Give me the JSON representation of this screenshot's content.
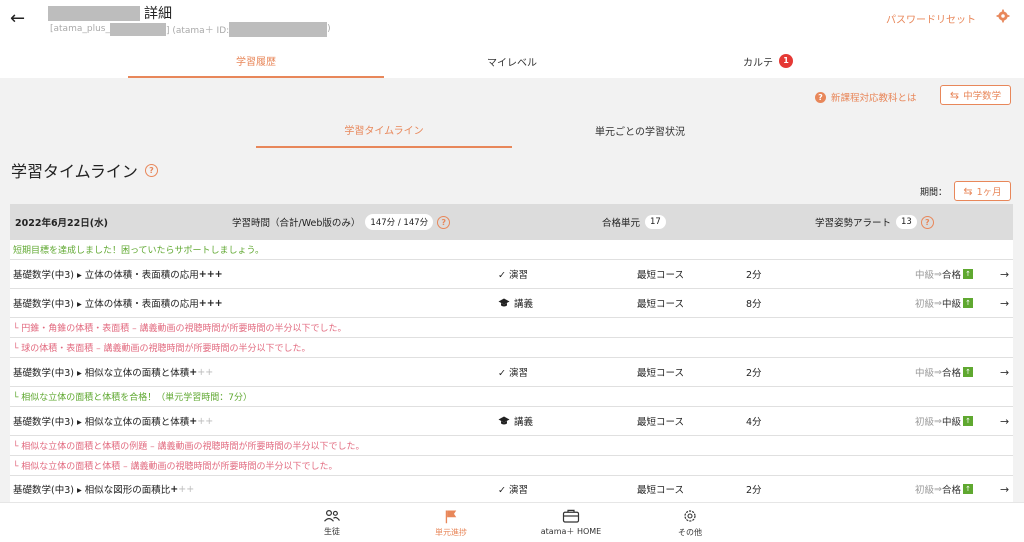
{
  "header": {
    "title_suffix": "詳細",
    "sub_prefix": "[atama_plus_",
    "sub_mid": "] (atama＋ ID:",
    "sub_suffix": ")",
    "password_reset": "パスワードリセット"
  },
  "tabs": [
    {
      "label": "学習履歴"
    },
    {
      "label": "マイレベル"
    },
    {
      "label": "カルテ",
      "badge": "1"
    }
  ],
  "curriculum": {
    "link_label": "新課程対応教科とは",
    "subject_button": "中学数学"
  },
  "subtabs": [
    {
      "label": "学習タイムライン"
    },
    {
      "label": "単元ごとの学習状況"
    }
  ],
  "section": {
    "title": "学習タイムライン",
    "period_label": "期間：",
    "period_value": "1ヶ月"
  },
  "summary": {
    "date": "2022年6月22日(水)",
    "time_label": "学習時間（合計/Web版のみ）",
    "time_value": "147分 / 147分",
    "pass_label": "合格単元",
    "pass_value": "17",
    "alert_label": "学習姿勢アラート",
    "alert_value": "13"
  },
  "timeline": {
    "goal_note": "短期目標を達成しました！困っていたらサポートしましょう。",
    "rows": [
      {
        "unit": "基礎数学(中3) ▸ 立体の体積・表面積の応用",
        "plus_on": "+++",
        "plus_off": "",
        "type": "✓ 演習",
        "course": "最短コース",
        "time": "2分",
        "lv_from": "中級",
        "lv_to": "合格",
        "arrow": "→"
      },
      {
        "unit": "基礎数学(中3) ▸ 立体の体積・表面積の応用",
        "plus_on": "+++",
        "plus_off": "",
        "type": "講義",
        "course": "最短コース",
        "time": "8分",
        "lv_from": "初級",
        "lv_to": "中級",
        "arrow": "→"
      },
      {
        "unit": "基礎数学(中3) ▸ 相似な立体の面積と体積",
        "plus_on": "+",
        "plus_off": "++",
        "type": "✓ 演習",
        "course": "最短コース",
        "time": "2分",
        "lv_from": "中級",
        "lv_to": "合格",
        "arrow": "→"
      },
      {
        "unit": "基礎数学(中3) ▸ 相似な立体の面積と体積",
        "plus_on": "+",
        "plus_off": "++",
        "type": "講義",
        "course": "最短コース",
        "time": "4分",
        "lv_from": "初級",
        "lv_to": "中級",
        "arrow": "→"
      },
      {
        "unit": "基礎数学(中3) ▸ 相似な図形の面積比",
        "plus_on": "+",
        "plus_off": "++",
        "type": "✓ 演習",
        "course": "最短コース",
        "time": "2分",
        "lv_from": "初級",
        "lv_to": "合格",
        "arrow": "→"
      }
    ],
    "notes": [
      "└ 円錐・角錐の体積・表面積 – 講義動画の視聴時間が所要時間の半分以下でした。",
      "└ 球の体積・表面積 – 講義動画の視聴時間が所要時間の半分以下でした。",
      "└ 相似な立体の面積と体積を合格！（単元学習時間：7分）",
      "└ 相似な立体の面積と体積の例題 – 講義動画の視聴時間が所要時間の半分以下でした。",
      "└ 相似な立体の面積と体積 – 講義動画の視聴時間が所要時間の半分以下でした。"
    ],
    "up_mark": "↑"
  },
  "bottom_nav": [
    {
      "label": "生徒",
      "icon": "people-icon"
    },
    {
      "label": "単元進捗",
      "icon": "flag-icon"
    },
    {
      "label": "atama＋ HOME",
      "icon": "briefcase-icon"
    },
    {
      "label": "その他",
      "icon": "gear-icon"
    }
  ],
  "colors": {
    "accent": "#e8875a",
    "green": "#5fa830",
    "red_note": "#e26a7f",
    "badge_red": "#e53935"
  }
}
